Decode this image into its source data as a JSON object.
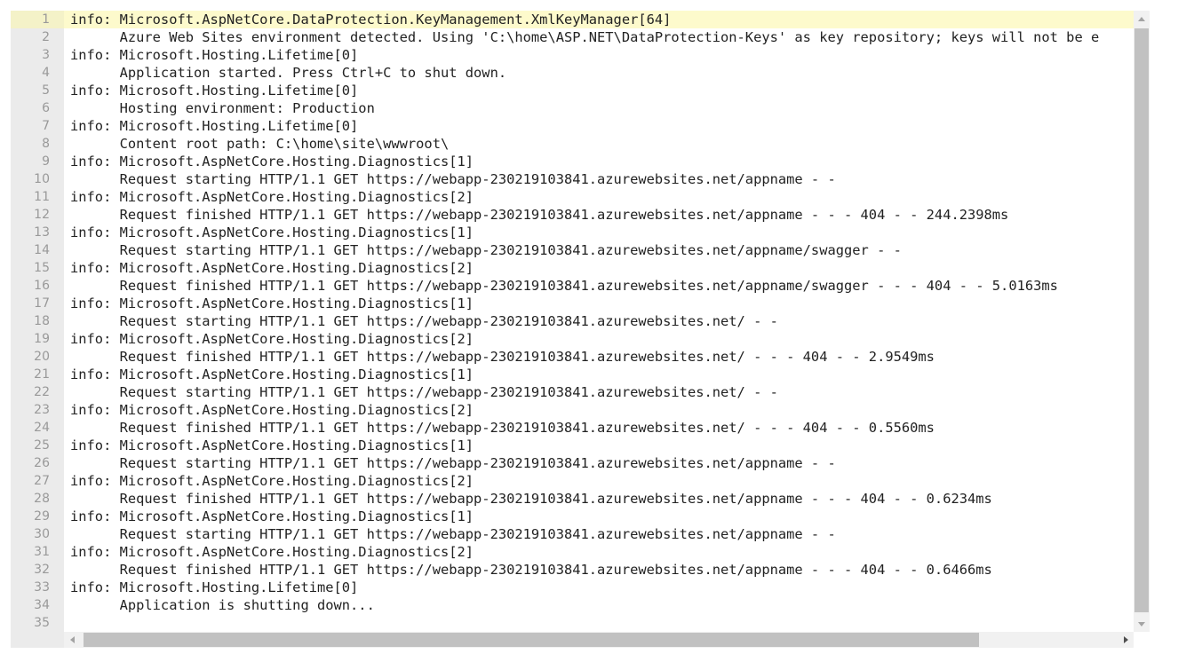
{
  "editor": {
    "active_line": 1,
    "colors": {
      "gutter_bg": "#ebebeb",
      "active_line_bg": "#fdfacc",
      "text": "#222222",
      "line_number": "#999999",
      "scrollbar_track": "#f1f1f1",
      "scrollbar_thumb": "#c1c1c1"
    },
    "lines": [
      {
        "number": "1",
        "text": "info: Microsoft.AspNetCore.DataProtection.KeyManagement.XmlKeyManager[64]"
      },
      {
        "number": "2",
        "text": "      Azure Web Sites environment detected. Using 'C:\\home\\ASP.NET\\DataProtection-Keys' as key repository; keys will not be e"
      },
      {
        "number": "3",
        "text": "info: Microsoft.Hosting.Lifetime[0]"
      },
      {
        "number": "4",
        "text": "      Application started. Press Ctrl+C to shut down."
      },
      {
        "number": "5",
        "text": "info: Microsoft.Hosting.Lifetime[0]"
      },
      {
        "number": "6",
        "text": "      Hosting environment: Production"
      },
      {
        "number": "7",
        "text": "info: Microsoft.Hosting.Lifetime[0]"
      },
      {
        "number": "8",
        "text": "      Content root path: C:\\home\\site\\wwwroot\\"
      },
      {
        "number": "9",
        "text": "info: Microsoft.AspNetCore.Hosting.Diagnostics[1]"
      },
      {
        "number": "10",
        "text": "      Request starting HTTP/1.1 GET https://webapp-230219103841.azurewebsites.net/appname - -"
      },
      {
        "number": "11",
        "text": "info: Microsoft.AspNetCore.Hosting.Diagnostics[2]"
      },
      {
        "number": "12",
        "text": "      Request finished HTTP/1.1 GET https://webapp-230219103841.azurewebsites.net/appname - - - 404 - - 244.2398ms"
      },
      {
        "number": "13",
        "text": "info: Microsoft.AspNetCore.Hosting.Diagnostics[1]"
      },
      {
        "number": "14",
        "text": "      Request starting HTTP/1.1 GET https://webapp-230219103841.azurewebsites.net/appname/swagger - -"
      },
      {
        "number": "15",
        "text": "info: Microsoft.AspNetCore.Hosting.Diagnostics[2]"
      },
      {
        "number": "16",
        "text": "      Request finished HTTP/1.1 GET https://webapp-230219103841.azurewebsites.net/appname/swagger - - - 404 - - 5.0163ms"
      },
      {
        "number": "17",
        "text": "info: Microsoft.AspNetCore.Hosting.Diagnostics[1]"
      },
      {
        "number": "18",
        "text": "      Request starting HTTP/1.1 GET https://webapp-230219103841.azurewebsites.net/ - -"
      },
      {
        "number": "19",
        "text": "info: Microsoft.AspNetCore.Hosting.Diagnostics[2]"
      },
      {
        "number": "20",
        "text": "      Request finished HTTP/1.1 GET https://webapp-230219103841.azurewebsites.net/ - - - 404 - - 2.9549ms"
      },
      {
        "number": "21",
        "text": "info: Microsoft.AspNetCore.Hosting.Diagnostics[1]"
      },
      {
        "number": "22",
        "text": "      Request starting HTTP/1.1 GET https://webapp-230219103841.azurewebsites.net/ - -"
      },
      {
        "number": "23",
        "text": "info: Microsoft.AspNetCore.Hosting.Diagnostics[2]"
      },
      {
        "number": "24",
        "text": "      Request finished HTTP/1.1 GET https://webapp-230219103841.azurewebsites.net/ - - - 404 - - 0.5560ms"
      },
      {
        "number": "25",
        "text": "info: Microsoft.AspNetCore.Hosting.Diagnostics[1]"
      },
      {
        "number": "26",
        "text": "      Request starting HTTP/1.1 GET https://webapp-230219103841.azurewebsites.net/appname - -"
      },
      {
        "number": "27",
        "text": "info: Microsoft.AspNetCore.Hosting.Diagnostics[2]"
      },
      {
        "number": "28",
        "text": "      Request finished HTTP/1.1 GET https://webapp-230219103841.azurewebsites.net/appname - - - 404 - - 0.6234ms"
      },
      {
        "number": "29",
        "text": "info: Microsoft.AspNetCore.Hosting.Diagnostics[1]"
      },
      {
        "number": "30",
        "text": "      Request starting HTTP/1.1 GET https://webapp-230219103841.azurewebsites.net/appname - -"
      },
      {
        "number": "31",
        "text": "info: Microsoft.AspNetCore.Hosting.Diagnostics[2]"
      },
      {
        "number": "32",
        "text": "      Request finished HTTP/1.1 GET https://webapp-230219103841.azurewebsites.net/appname - - - 404 - - 0.6466ms"
      },
      {
        "number": "33",
        "text": "info: Microsoft.Hosting.Lifetime[0]"
      },
      {
        "number": "34",
        "text": "      Application is shutting down..."
      },
      {
        "number": "35",
        "text": ""
      }
    ]
  },
  "scrollbars": {
    "vertical": {
      "up_icon": "chevron-up-icon",
      "down_icon": "chevron-down-icon"
    },
    "horizontal": {
      "left_icon": "chevron-left-icon",
      "right_icon": "chevron-right-icon"
    }
  }
}
